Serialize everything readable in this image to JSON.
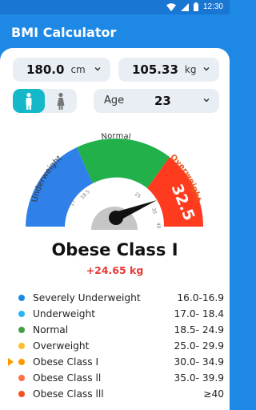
{
  "status_bar": {
    "time": "12:30"
  },
  "app": {
    "title": "BMI Calculator"
  },
  "inputs": {
    "height": {
      "value": "180.0",
      "unit": "cm"
    },
    "weight": {
      "value": "105.33",
      "unit": "kg"
    },
    "age": {
      "label": "Age",
      "value": "23"
    },
    "gender_selected": "male"
  },
  "gauge": {
    "bmi_value": 32.5,
    "bmi_text": "32.5",
    "labels": {
      "underweight": "Underweight",
      "normal": "Normal",
      "overweight": "Overweight"
    },
    "ticks": [
      "17",
      "18.5",
      "25",
      "30",
      "40"
    ],
    "colors": {
      "underweight": "#2f80e8",
      "normal": "#22b04b",
      "overweight": "#ff3b1f",
      "needle": "#111111",
      "hub": "#c6c6c6"
    }
  },
  "result": {
    "title": "Obese Class I",
    "difference": "+24.65 kg"
  },
  "legend": [
    {
      "name": "Severely Underweight",
      "range": "16.0-16.9",
      "color": "#1e88e5",
      "selected": false
    },
    {
      "name": "Underweight",
      "range": "17.0- 18.4",
      "color": "#29b6f6",
      "selected": false
    },
    {
      "name": "Normal",
      "range": "18.5- 24.9",
      "color": "#43a047",
      "selected": false
    },
    {
      "name": "Overweight",
      "range": "25.0- 29.9",
      "color": "#fbc02d",
      "selected": false
    },
    {
      "name": "Obese Class I",
      "range": "30.0- 34.9",
      "color": "#ff9800",
      "selected": true
    },
    {
      "name": "Obese Class ll",
      "range": "35.0- 39.9",
      "color": "#ff7043",
      "selected": false
    },
    {
      "name": "Obese Class lll",
      "range": "≥40",
      "color": "#f4511e",
      "selected": false
    }
  ]
}
